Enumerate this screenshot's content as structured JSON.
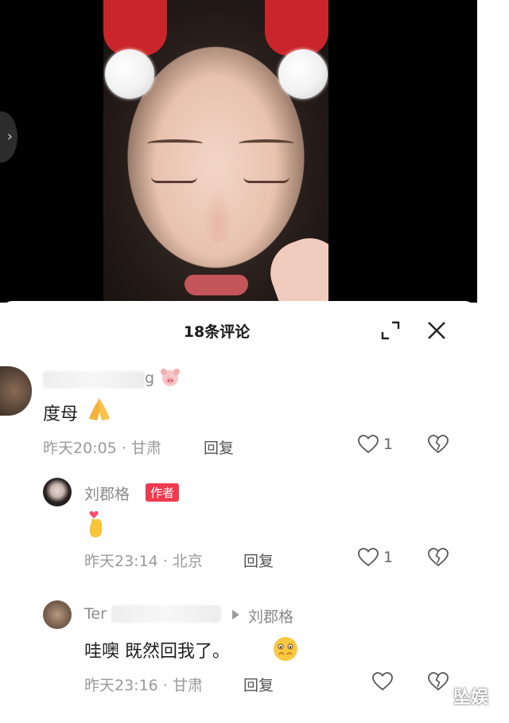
{
  "panel": {
    "title": "18条评论"
  },
  "comments": [
    {
      "username_suffix": "g",
      "text": "度母",
      "time": "昨天20:05",
      "location": "甘肃",
      "reply_label": "回复",
      "likes": "1"
    },
    {
      "username": "刘郡格",
      "badge": "作者",
      "time": "昨天23:14",
      "location": "北京",
      "reply_label": "回复",
      "likes": "1"
    },
    {
      "username_prefix": "Ter",
      "reply_to": "刘郡格",
      "text": "哇噢  既然回我了。",
      "time": "昨天23:16",
      "location": "甘肃",
      "reply_label": "回复"
    }
  ],
  "meta_separator": "·",
  "watermark": "坠娱",
  "icons": {
    "nav": "chevron-right-icon",
    "expand": "expand-icon",
    "close": "close-icon",
    "like": "heart-outline-icon",
    "dislike": "broken-heart-icon"
  },
  "colors": {
    "author_badge": "#f03a4e",
    "headband": "#c9252a"
  }
}
